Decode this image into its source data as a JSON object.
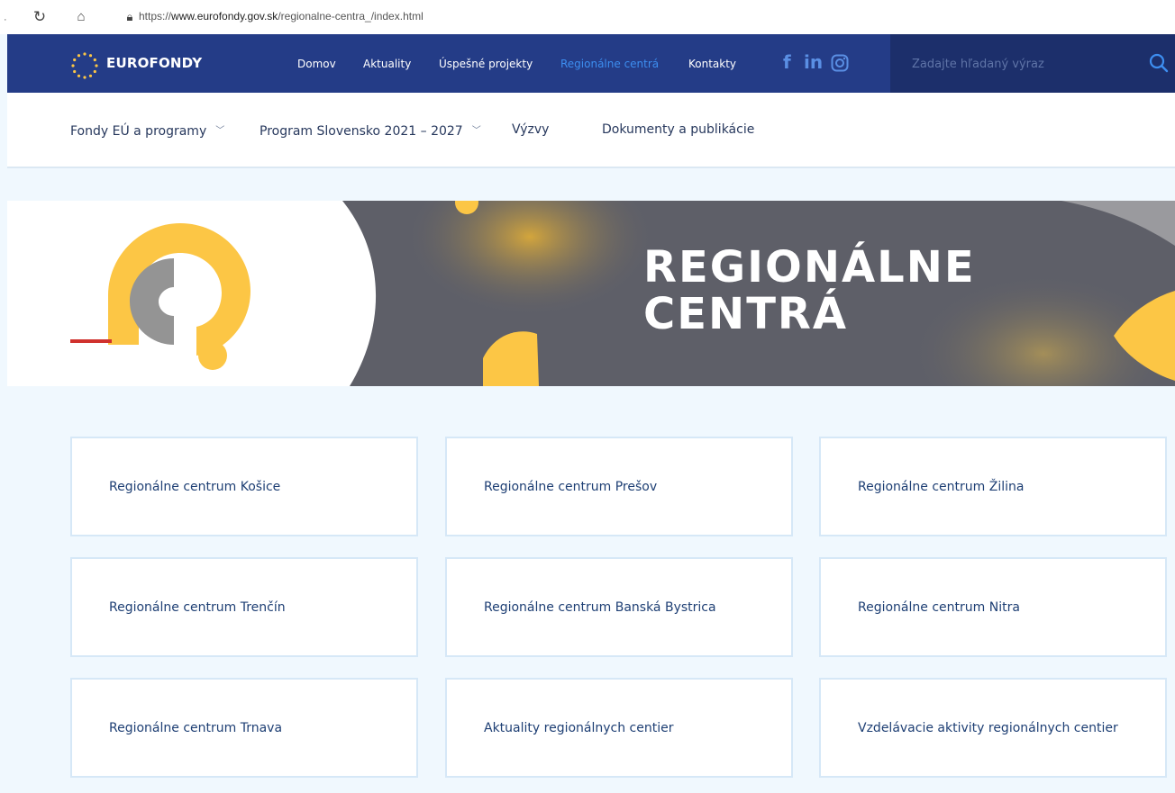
{
  "browser": {
    "url_prefix": "https://",
    "url_host": "www.eurofondy.gov.sk",
    "url_path": "/regionalne-centra_/index.html"
  },
  "header": {
    "logo_text": "EUROFONDY",
    "nav": [
      "Domov",
      "Aktuality",
      "Úspešné projekty",
      "Regionálne centrá",
      "Kontakty"
    ],
    "active_nav": "Regionálne centrá",
    "social": [
      "facebook-icon",
      "linkedin-icon",
      "instagram-icon"
    ],
    "search_placeholder": "Zadajte hľadaný výraz"
  },
  "subnav": {
    "items": [
      "Fondy EÚ a programy",
      "Program Slovensko 2021 – 2027",
      "Výzvy",
      "Dokumenty a publikácie"
    ]
  },
  "hero": {
    "title_line1": "REGIONÁLNE",
    "title_line2": "CENTRÁ"
  },
  "cards": [
    "Regionálne centrum Košice",
    "Regionálne centrum Prešov",
    "Regionálne centrum Žilina",
    "Regionálne centrum Trenčín",
    "Regionálne centrum Banská Bystrica",
    "Regionálne centrum Nitra",
    "Regionálne centrum Trnava",
    "Aktuality regionálnych centier",
    "Vzdelávacie aktivity regionálnych centier"
  ],
  "colors": {
    "nav_bg": "#243c87",
    "search_bg": "#1c2f6b",
    "active_link": "#3d8ef0",
    "accent_yellow": "#fcc645",
    "hero_gray": "#5e5f68",
    "card_text": "#1e3f74"
  }
}
